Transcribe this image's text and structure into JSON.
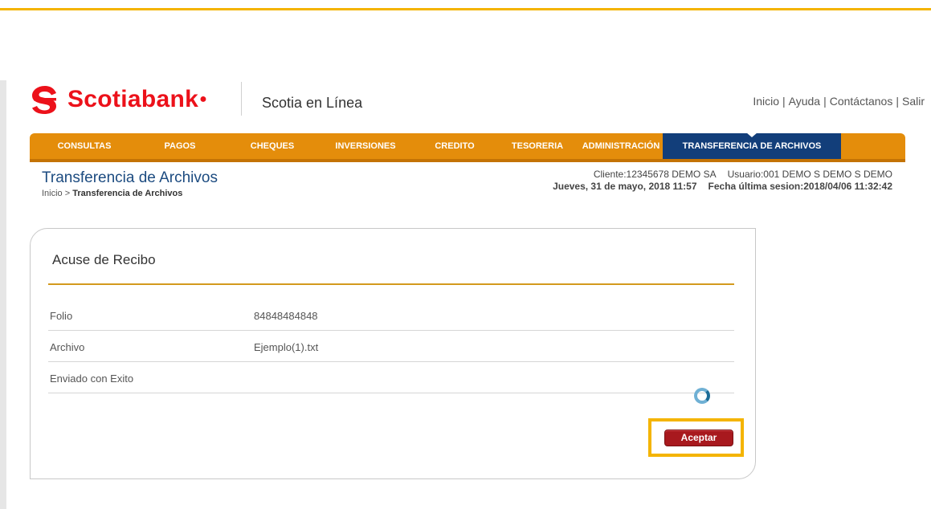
{
  "brand": {
    "logo_text": "Scotiabank",
    "app_name": "Scotia en Línea",
    "brand_color": "#ec111a"
  },
  "top_links": [
    "Inicio",
    "Ayuda",
    "Contáctanos",
    "Salir"
  ],
  "nav": {
    "items": [
      {
        "label": "CONSULTAS"
      },
      {
        "label": "PAGOS"
      },
      {
        "label": "CHEQUES"
      },
      {
        "label": "INVERSIONES"
      },
      {
        "label": "CREDITO"
      },
      {
        "label": "TESORERIA"
      },
      {
        "label": "ADMINISTRACIÓN"
      },
      {
        "label": "TRANSFERENCIA DE ARCHIVOS"
      }
    ],
    "active": "TRANSFERENCIA DE ARCHIVOS",
    "bar_color": "#e48d0b",
    "active_color": "#123e7a"
  },
  "page": {
    "title": "Transferencia de Archivos",
    "breadcrumb_home": "Inicio",
    "breadcrumb_sep": " > ",
    "breadcrumb_current": "Transferencia de Archivos"
  },
  "client": {
    "cliente": "Cliente:12345678  DEMO SA",
    "usuario": "Usuario:001 DEMO S DEMO S DEMO",
    "fecha": "Jueves, 31 de mayo, 2018 11:57",
    "ultima_sesion": "Fecha última sesion:2018/04/06 11:32:42"
  },
  "receipt": {
    "title": "Acuse de Recibo",
    "rows": [
      {
        "label": "Folio",
        "value": "84848484848"
      },
      {
        "label": "Archivo",
        "value": "Ejemplo(1).txt"
      },
      {
        "label": "Enviado con Exito",
        "value": ""
      }
    ],
    "accept_label": "Aceptar"
  },
  "icons": {
    "logo": "scotiabank-s-logo-icon",
    "spinner": "loading-spinner-icon"
  }
}
